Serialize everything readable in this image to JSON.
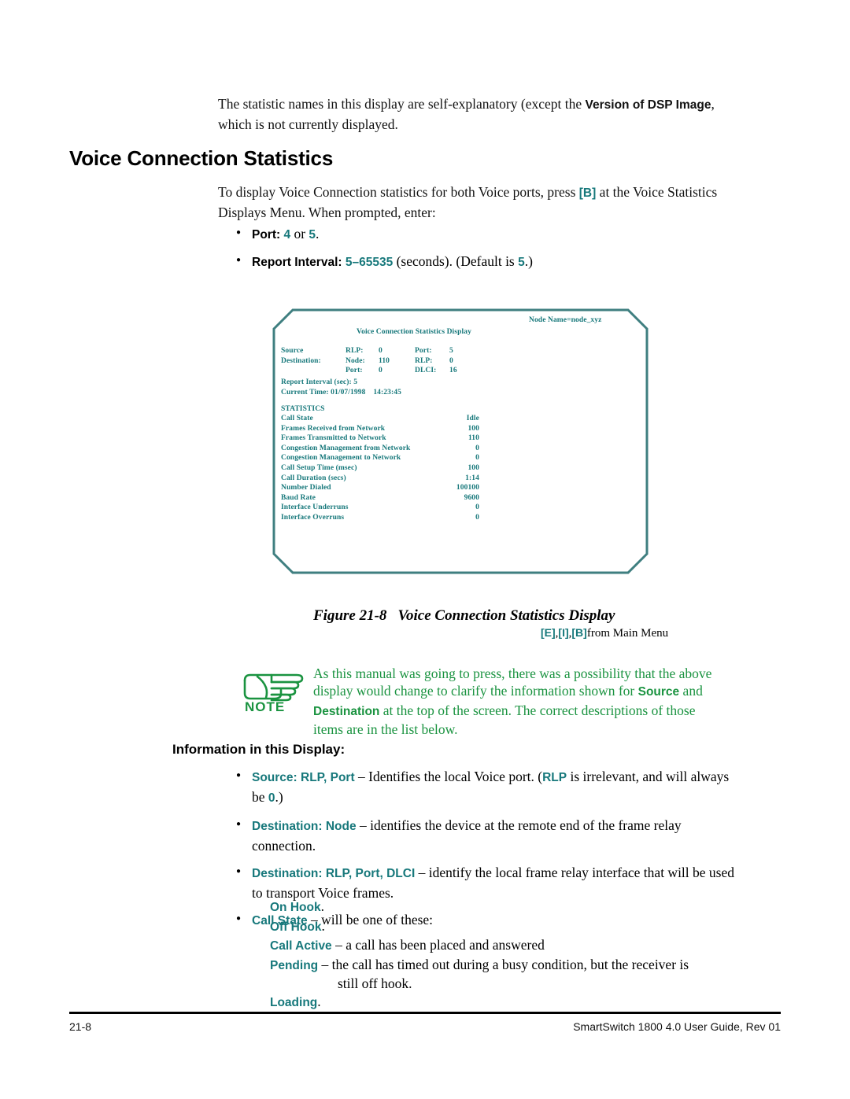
{
  "intro": {
    "text_1": "The statistic names in this display are self-explanatory (except the ",
    "bold_1": "Version of DSP Image",
    "text_2": ", which is not currently displayed."
  },
  "heading": "Voice Connection Statistics",
  "instructions": {
    "text_1": "To display Voice Connection statistics for both Voice ports, press ",
    "key": "[B]",
    "text_2": " at the Voice Statistics Displays Menu. When prompted, enter:"
  },
  "prompt_list": [
    {
      "label": "Port",
      "sep": ": ",
      "value_a": "4",
      "mid": " or ",
      "value_b": "5",
      "tail": "."
    },
    {
      "label": "Report Interval",
      "sep": ": ",
      "value_a": "5–65535",
      "mid": " (seconds). (Default is ",
      "value_b": "5",
      "tail": ".)"
    }
  ],
  "terminal": {
    "node_name": "Node Name=node_xyz",
    "title": "Voice Connection Statistics Display",
    "address_rows": [
      {
        "c1": "Source",
        "c2": "RLP:",
        "c3": "0",
        "c4": "Port:",
        "c5": "5"
      },
      {
        "c1": "Destination:",
        "c2": "Node:",
        "c3": "110",
        "c4": "RLP:",
        "c5": "0"
      },
      {
        "c1": "",
        "c2": "Port:",
        "c3": "0",
        "c4": "DLCI:",
        "c5": "16"
      }
    ],
    "report_interval": "Report Interval (sec): 5",
    "current_time": "Current Time: 01/07/1998    14:23:45",
    "stats_heading": "STATISTICS",
    "stats": [
      {
        "label": "Call State",
        "value": "Idle"
      },
      {
        "label": "Frames Received from Network",
        "value": "100"
      },
      {
        "label": "Frames Transmitted to Network",
        "value": "110"
      },
      {
        "label": "Congestion Management from Network",
        "value": "0"
      },
      {
        "label": "Congestion Management to Network",
        "value": "0"
      },
      {
        "label": "Call Setup Time (msec)",
        "value": "100"
      },
      {
        "label": "Call Duration (secs)",
        "value": "1:14"
      },
      {
        "label": "Number Dialed",
        "value": "100100"
      },
      {
        "label": "Baud Rate",
        "value": "9600"
      },
      {
        "label": "Interface Underruns",
        "value": "0"
      },
      {
        "label": "Interface Overruns",
        "value": "0"
      }
    ]
  },
  "figure": {
    "number": "Figure 21-8",
    "title": "Voice Connection Statistics Display",
    "key_e": "[E]",
    "key_i": "[I]",
    "key_b": "[B]",
    "keys_sep1": ",",
    "keys_sep2": ",",
    "keys_tail": "from Main Menu"
  },
  "note": {
    "icon_label": "NOTE",
    "text_1": "As this manual was going to press, there was a possibility that the above display would change to clarify the information shown for ",
    "bold_1": "Source",
    "text_2": " and ",
    "bold_2": "Destination",
    "text_3": " at the top of the screen. The correct descriptions of those items are in the list below."
  },
  "info": {
    "heading": "Information in this Display:",
    "bullets": [
      {
        "term": "Source: RLP, Port",
        "text_1": " – Identifies the local Voice port. (",
        "term_2": "RLP",
        "text_2": " is irrelevant, and will always be ",
        "term_3": "0",
        "text_3": ".)"
      },
      {
        "term": "Destination: Node",
        "text_1": " – identifies the device at the remote end of the frame relay connection.",
        "term_2": "",
        "text_2": "",
        "term_3": "",
        "text_3": ""
      },
      {
        "term": "Destination: RLP, Port, DLCI",
        "text_1": " – identify the local frame relay interface that will be used to transport Voice frames.",
        "term_2": "",
        "text_2": "",
        "term_3": "",
        "text_3": ""
      },
      {
        "term": "Call State",
        "text_1": " – will be one of these:",
        "term_2": "",
        "text_2": "",
        "term_3": "",
        "text_3": ""
      }
    ],
    "call_states": [
      {
        "term": "On Hook",
        "text": "."
      },
      {
        "term": "Off Hook",
        "text": "."
      },
      {
        "term": "Call Active",
        "text": " – a call has been placed and answered"
      },
      {
        "term": "Pending",
        "text": " – the call has timed out during a busy condition, but the receiver is",
        "text_indent": "still off hook."
      },
      {
        "term": "Loading",
        "text": "."
      }
    ]
  },
  "footer": {
    "page_number": "21-8",
    "guide": "SmartSwitch 1800 4.0 User Guide, Rev 01"
  },
  "colors": {
    "teal": "#17787b",
    "green": "#1a9340",
    "black": "#000000"
  }
}
